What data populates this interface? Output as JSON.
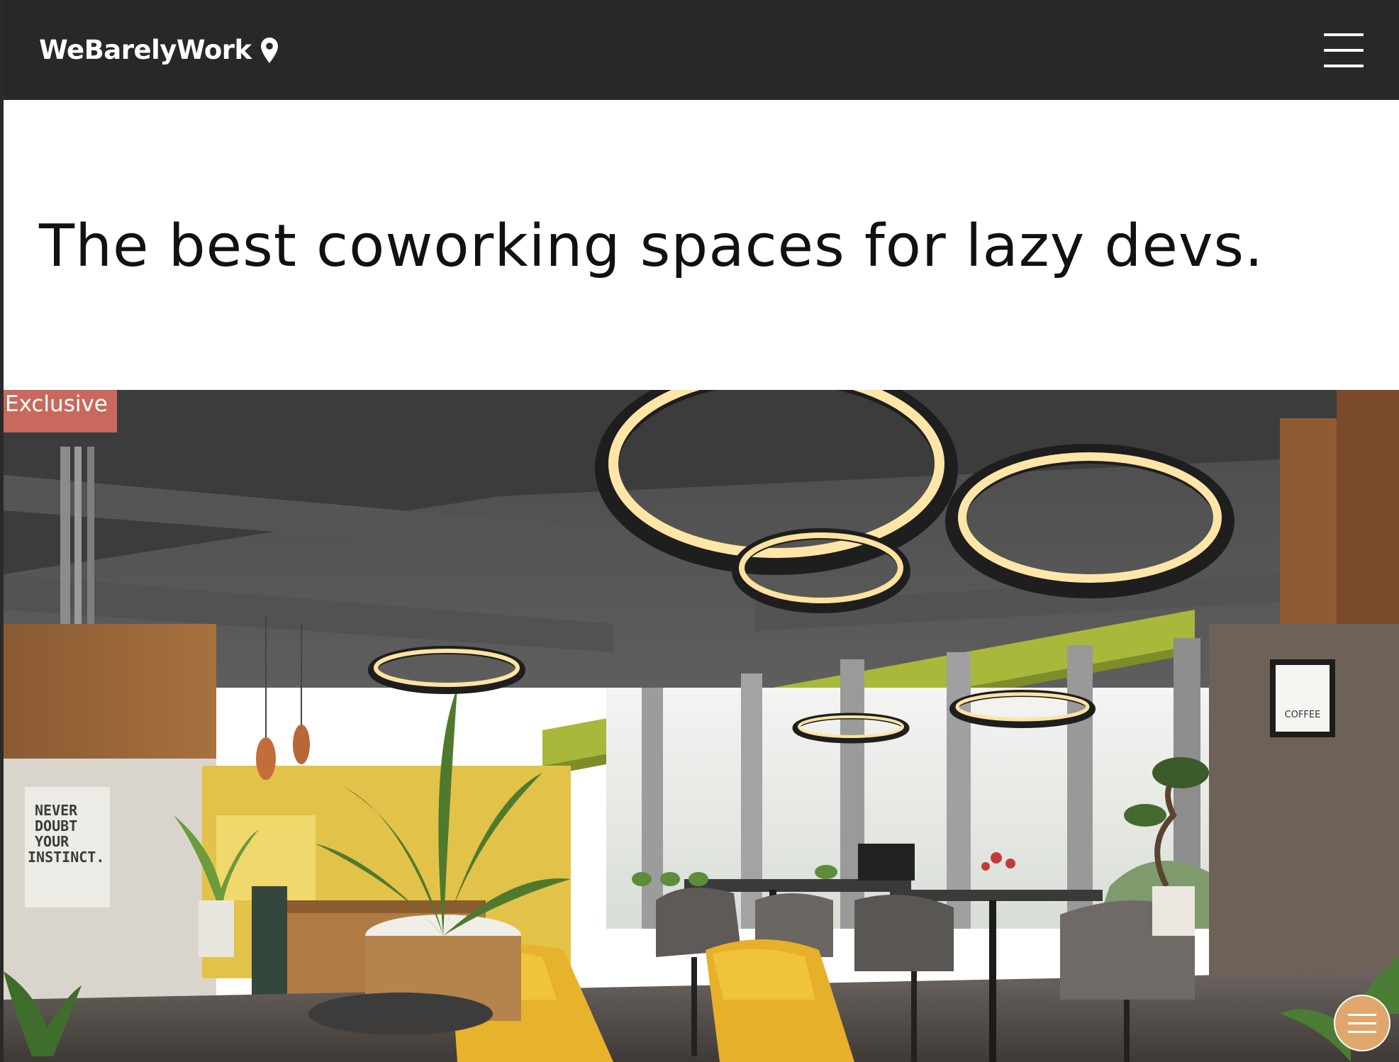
{
  "header": {
    "brand_name": "WeBarelyWork",
    "brand_icon": "map-pin-icon",
    "menu_icon": "hamburger-menu-icon",
    "background": "#282828"
  },
  "hero": {
    "title": "The best coworking spaces for lazy devs."
  },
  "listing": {
    "badge": "Exclusive",
    "badge_color": "#c9695d",
    "image_description": "coworking-space-photo",
    "wall_sign": "NEVER DOUBT YOUR INSTINCT.",
    "poster_text": "COFFEE"
  },
  "floating_button": {
    "icon": "hamburger-menu-icon",
    "color": "#e0a76d"
  }
}
